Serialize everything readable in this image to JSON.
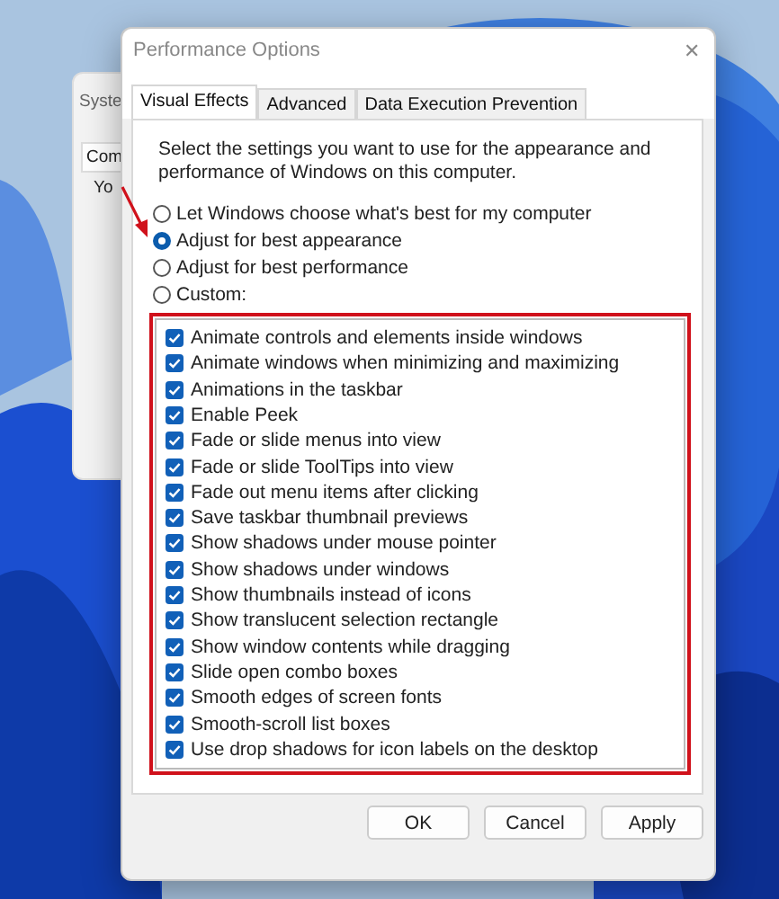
{
  "background_window": {
    "title": "Syste",
    "tab": "Com",
    "text": "Yo"
  },
  "window": {
    "title": "Performance Options",
    "close": "✕"
  },
  "tabs": [
    {
      "label": "Visual Effects",
      "selected": true
    },
    {
      "label": "Advanced",
      "selected": false
    },
    {
      "label": "Data Execution Prevention",
      "selected": false
    }
  ],
  "description": "Select the settings you want to use for the appearance and performance of Windows on this computer.",
  "options": [
    {
      "label": "Let Windows choose what's best for my computer",
      "selected": false
    },
    {
      "label": "Adjust for best appearance",
      "selected": true
    },
    {
      "label": "Adjust for best performance",
      "selected": false
    },
    {
      "label": "Custom:",
      "selected": false
    }
  ],
  "effects": [
    {
      "label": "Animate controls and elements inside windows",
      "checked": true
    },
    {
      "label": "Animate windows when minimizing and maximizing",
      "checked": true
    },
    {
      "label": "Animations in the taskbar",
      "checked": true
    },
    {
      "label": "Enable Peek",
      "checked": true
    },
    {
      "label": "Fade or slide menus into view",
      "checked": true
    },
    {
      "label": "Fade or slide ToolTips into view",
      "checked": true
    },
    {
      "label": "Fade out menu items after clicking",
      "checked": true
    },
    {
      "label": "Save taskbar thumbnail previews",
      "checked": true
    },
    {
      "label": "Show shadows under mouse pointer",
      "checked": true
    },
    {
      "label": "Show shadows under windows",
      "checked": true
    },
    {
      "label": "Show thumbnails instead of icons",
      "checked": true
    },
    {
      "label": "Show translucent selection rectangle",
      "checked": true
    },
    {
      "label": "Show window contents while dragging",
      "checked": true
    },
    {
      "label": "Slide open combo boxes",
      "checked": true
    },
    {
      "label": "Smooth edges of screen fonts",
      "checked": true
    },
    {
      "label": "Smooth-scroll list boxes",
      "checked": true
    },
    {
      "label": "Use drop shadows for icon labels on the desktop",
      "checked": true
    }
  ],
  "buttons": [
    "OK",
    "Cancel",
    "Apply"
  ]
}
